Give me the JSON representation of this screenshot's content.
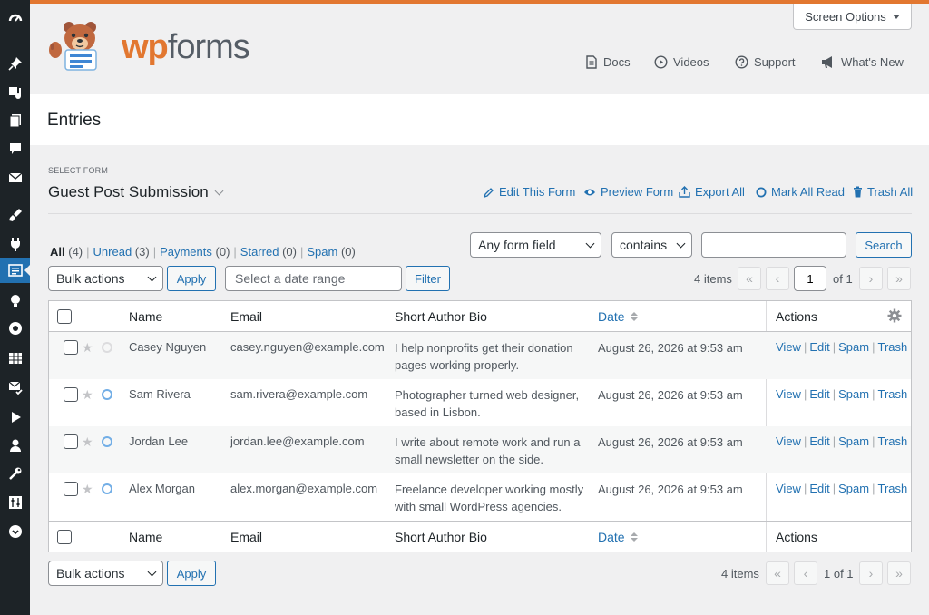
{
  "header": {
    "screen_options": "Screen Options",
    "logo": {
      "wp": "wp",
      "forms": "forms"
    },
    "links": [
      {
        "label": "Docs",
        "icon": "document-icon"
      },
      {
        "label": "Videos",
        "icon": "play-circle-icon"
      },
      {
        "label": "Support",
        "icon": "help-circle-icon"
      },
      {
        "label": "What's New",
        "icon": "megaphone-icon"
      }
    ]
  },
  "page": {
    "title": "Entries"
  },
  "form_select": {
    "label": "SELECT FORM",
    "current": "Guest Post Submission",
    "actions": [
      {
        "label": "Edit This Form",
        "icon": "pencil-icon"
      },
      {
        "label": "Preview Form",
        "icon": "eye-icon"
      },
      {
        "label": "Export All",
        "icon": "export-icon"
      },
      {
        "label": "Mark All Read",
        "icon": "circle-icon"
      },
      {
        "label": "Trash All",
        "icon": "trash-icon"
      }
    ]
  },
  "filters": {
    "views": [
      {
        "label": "All",
        "count": "(4)"
      },
      {
        "label": "Unread",
        "count": "(3)"
      },
      {
        "label": "Payments",
        "count": "(0)"
      },
      {
        "label": "Starred",
        "count": "(0)"
      },
      {
        "label": "Spam",
        "count": "(0)"
      }
    ],
    "field_select": "Any form field",
    "operator_select": "contains",
    "search_value": "",
    "search_button": "Search"
  },
  "toolbar_top": {
    "bulk_actions": "Bulk actions",
    "apply": "Apply",
    "date_placeholder": "Select a date range",
    "filter": "Filter",
    "items": "4 items",
    "page_value": "1",
    "of_pages": "of 1"
  },
  "table": {
    "columns": {
      "name": "Name",
      "email": "Email",
      "bio": "Short Author Bio",
      "date": "Date",
      "actions": "Actions"
    },
    "row_actions": {
      "view": "View",
      "edit": "Edit",
      "spam": "Spam",
      "trash": "Trash"
    },
    "rows": [
      {
        "name": "Casey Nguyen",
        "email": "casey.nguyen@example.com",
        "bio_1": "I help nonprofits get their donation",
        "bio_2": "pages working properly.",
        "date": "August 26, 2026 at 9:53 am",
        "unread": false
      },
      {
        "name": "Sam Rivera",
        "email": "sam.rivera@example.com",
        "bio_1": "Photographer turned web designer,",
        "bio_2": "based in Lisbon.",
        "date": "August 26, 2026 at 9:53 am",
        "unread": true
      },
      {
        "name": "Jordan Lee",
        "email": "jordan.lee@example.com",
        "bio_1": "I write about remote work and run a",
        "bio_2": "small newsletter on the side.",
        "date": "August 26, 2026 at 9:53 am",
        "unread": true
      },
      {
        "name": "Alex Morgan",
        "email": "alex.morgan@example.com",
        "bio_1": "Freelance developer working mostly",
        "bio_2": "with small WordPress agencies.",
        "date": "August 26, 2026 at 9:53 am",
        "unread": true
      }
    ]
  },
  "toolbar_bottom": {
    "bulk_actions": "Bulk actions",
    "apply": "Apply",
    "items": "4 items",
    "page_text": "1 of 1"
  },
  "colors": {
    "accent": "#2271b1",
    "brand": "#e27730",
    "sidebar": "#1d2327"
  }
}
